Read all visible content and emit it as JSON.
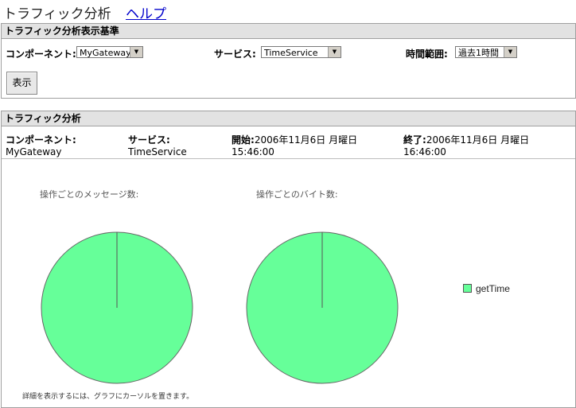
{
  "header": {
    "title": "トラフィック分析",
    "help_label": "ヘルプ"
  },
  "criteria": {
    "title": "トラフィック分析表示基準",
    "component_label": "コンポーネント:",
    "component_value": "MyGateway",
    "service_label": "サービス:",
    "service_value": "TimeService",
    "range_label": "時間範囲:",
    "range_value": "過去1時間",
    "show_button": "表示"
  },
  "analysis": {
    "title": "トラフィック分析",
    "component_label": "コンポーネント:",
    "component_value": "MyGateway",
    "service_label": "サービス:",
    "service_value": "TimeService",
    "start_label": "開始:",
    "start_date": "2006年11月6日 月曜日",
    "start_time": "15:46:00",
    "end_label": "終了:",
    "end_date": "2006年11月6日 月曜日",
    "end_time": "16:46:00",
    "footnote": "詳細を表示するには、グラフにカーソルを置きます。"
  },
  "chart_data": [
    {
      "type": "pie",
      "title": "操作ごとのメッセージ数:",
      "labels": [
        "getTime"
      ],
      "values": [
        100
      ],
      "colors": [
        "#66ff99"
      ]
    },
    {
      "type": "pie",
      "title": "操作ごとのバイト数:",
      "labels": [
        "getTime"
      ],
      "values": [
        100
      ],
      "colors": [
        "#66ff99"
      ]
    }
  ],
  "legend": {
    "items": [
      {
        "label": "getTime",
        "color": "#66ff99"
      }
    ]
  }
}
